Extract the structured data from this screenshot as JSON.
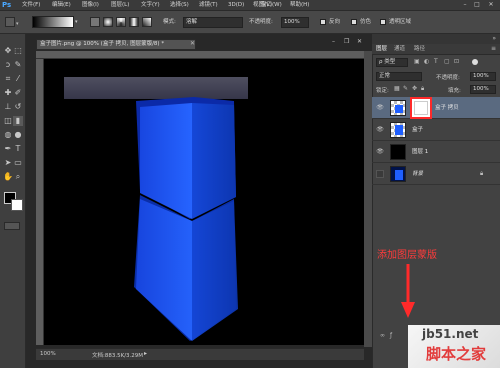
{
  "app": {
    "logo": "Ps"
  },
  "menu": [
    "文件(F)",
    "编辑(E)",
    "图像(I)",
    "图层(L)",
    "文字(Y)",
    "选择(S)",
    "滤镜(T)",
    "3D(D)",
    "视图(V)",
    "窗口(W)",
    "帮助(H)"
  ],
  "window_controls": [
    "–",
    "□",
    "✕"
  ],
  "options": {
    "mode_label": "模式:",
    "mode_value": "溶解",
    "opacity_label": "不透明度:",
    "opacity_value": "100%",
    "reverse_label": "反向",
    "dither_label": "仿色",
    "transparency_label": "透明区域"
  },
  "document": {
    "tab_title": "盒子图片.png @ 100% (盒子 拷贝, 图层蒙版/8) *",
    "zoom": "100%",
    "doc_info": "文档:883.5K/3.29M"
  },
  "panels": {
    "tabs": [
      "图层",
      "通道",
      "路径"
    ],
    "filter_kind": "ρ 类型",
    "blend_mode": "正常",
    "opacity_label": "不透明度:",
    "opacity_value": "100%",
    "lock_label": "锁定:",
    "fill_label": "填充:",
    "fill_value": "100%"
  },
  "layers": [
    {
      "name": "盒子 拷贝"
    },
    {
      "name": "盒子"
    },
    {
      "name": "图层 1"
    },
    {
      "name": "背景"
    }
  ],
  "annotation": {
    "text": "添加图层蒙版",
    "color": "#ff3b3b"
  },
  "watermark": {
    "site": "jb51.net",
    "brand": "脚本之家"
  },
  "colors": {
    "box_blue": "#1f5fff",
    "highlight_red": "#ff2a2a"
  }
}
